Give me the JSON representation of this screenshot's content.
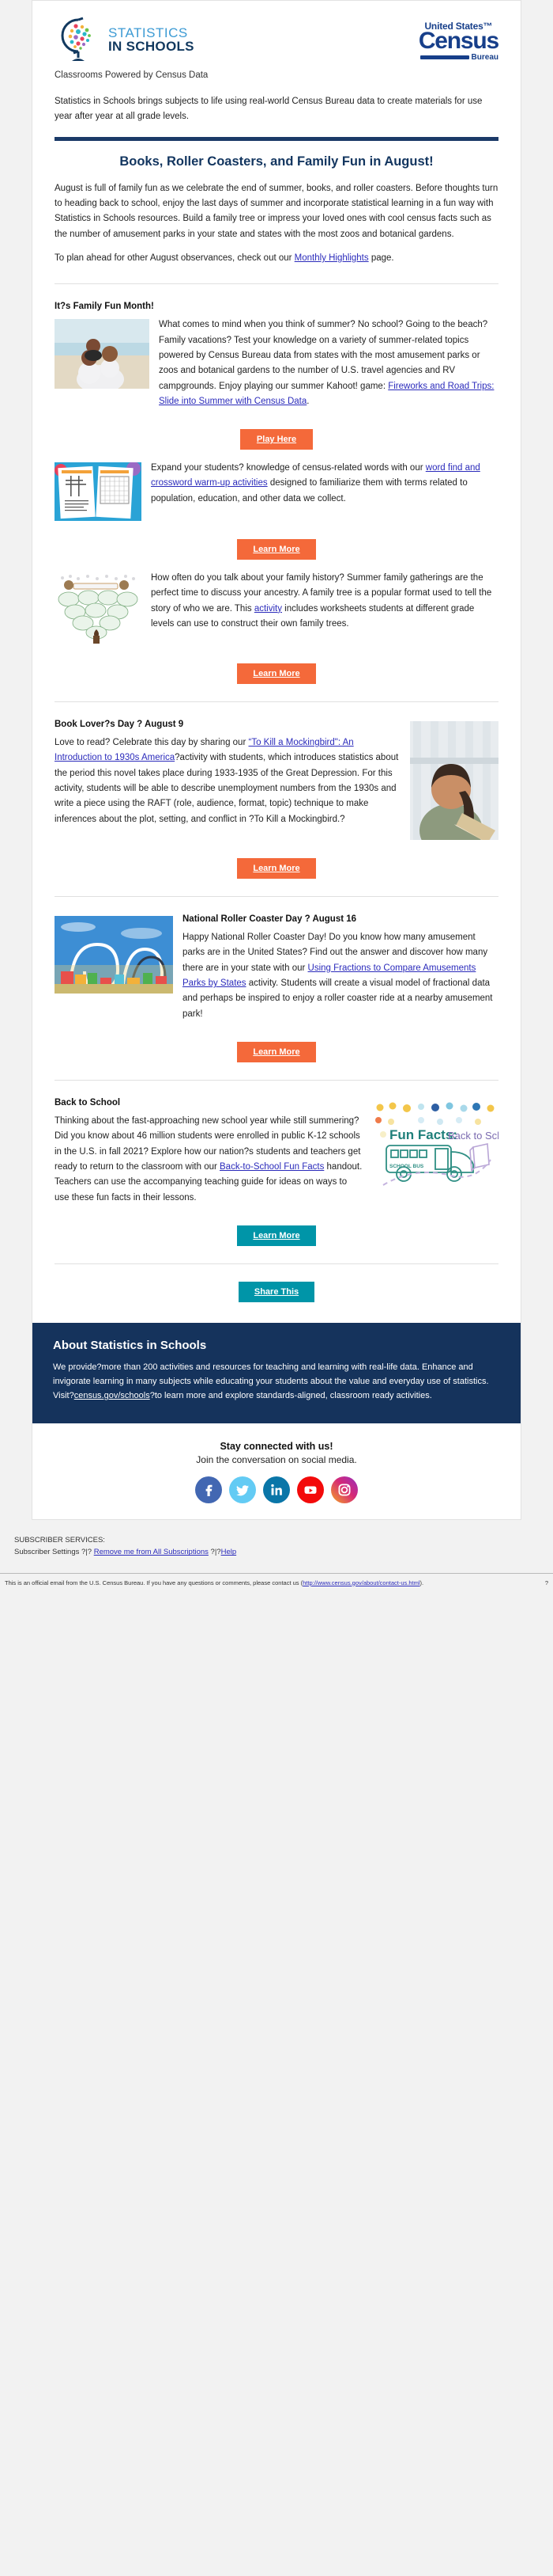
{
  "header": {
    "logo_line1": "STATISTICS",
    "logo_line2": "IN SCHOOLS",
    "census_us": "United States™",
    "census_name": "Census",
    "census_bureau": "Bureau",
    "tagline": "Classrooms Powered by Census Data"
  },
  "intro": "Statistics in Schools brings subjects to life using real-world Census Bureau data to create materials for use year after year at all grade levels.",
  "headline": "Books, Roller Coasters, and Family Fun in August!",
  "lede": {
    "p1": "August is full of family fun as we celebrate the end of summer, books, and roller coasters. Before thoughts turn to heading back to school, enjoy the last days of summer and incorporate statistical learning in a fun way with Statistics in Schools resources. Build a family tree or impress your loved ones with cool census facts such as the number of amusement parks in your state and states with the most zoos and botanical gardens.",
    "p2_before": "To plan ahead for other August observances, check out our ",
    "p2_link": "Monthly Highlights",
    "p2_after": " page."
  },
  "family_fun": {
    "title": "It?s Family Fun Month!",
    "block1": {
      "text_before": "What comes to mind when you think of summer? No school? Going to the beach? Family vacations? Test your knowledge on a variety of summer-related topics powered by Census Bureau data from states with the most amusement parks or zoos and botanical gardens to the number of U.S. travel agencies and RV campgrounds. Enjoy playing our summer Kahoot! game: ",
      "link": "Fireworks and Road Trips: Slide into Summer with Census Data",
      "text_after": ".",
      "button": "Play Here",
      "image_alt": "family-beach-photo"
    },
    "block2": {
      "text_before": "Expand your students? knowledge of census-related words with our ",
      "link": "word find and crossword warm-up activities",
      "text_after": " designed to familiarize them with terms related to population, education, and other data we collect.",
      "button": "Learn More",
      "image_alt": "crossword-worksheets-thumbnail"
    },
    "block3": {
      "text_before": "How often do you talk about your family history? Summer family gatherings are the perfect time to discuss your ancestry. A family tree is a popular format used to tell the story of who we are. This ",
      "link": "activity",
      "text_after": " includes worksheets students at different grade levels can use to construct their own family trees.",
      "button": "Learn More",
      "image_alt": "family-tree-worksheet-thumbnail"
    }
  },
  "book_lovers": {
    "title": "Book Lover?s Day ? August 9",
    "text_before": "Love to read? Celebrate this day by sharing our ",
    "link": "“To Kill a Mockingbird\": An Introduction to 1930s America",
    "text_after": "?activity with students, which introduces statistics about the period this novel takes place during 1933-1935 of the Great Depression. For this activity, students will be able to describe unemployment numbers from the 1930s and write a piece using the RAFT (role, audience, format, topic) technique to make inferences about the plot, setting, and conflict in ?To Kill a Mockingbird.?",
    "button": "Learn More",
    "image_alt": "girl-reading-book-photo"
  },
  "roller_coaster": {
    "title": "National Roller Coaster Day ? August 16",
    "text_before": "Happy National Roller Coaster Day! Do you know how many amusement parks are in the United States? Find out the answer and discover how many there are in your state with our ",
    "link": "Using Fractions to Compare Amusements Parks by States",
    "text_after": " activity. Students will create a visual model of fractional data and perhaps be inspired to enjoy a roller coaster ride at a nearby amusement park!",
    "button": "Learn More",
    "image_alt": "roller-coaster-photo"
  },
  "back_to_school": {
    "title": "Back to School",
    "text_before": "Thinking about the fast-approaching new school year while still summering? Did you know about 46 million students were enrolled in public K-12 schools in the U.S. in fall 2021? Explore how our nation?s students and teachers get ready to return to the classroom with our ",
    "link": "Back-to-School Fun Facts",
    "text_after": " handout. Teachers can use the accompanying teaching guide for ideas on ways to use these fun facts in their lessons.",
    "button": "Learn More",
    "image_alt": "fun-facts-back-to-school-bus-graphic",
    "image_caption_bold": "Fun Facts:",
    "image_caption_rest": " Back to School",
    "bus_label": "SCHOOL BUS"
  },
  "share_button": "Share This",
  "about": {
    "title": "About Statistics in Schools",
    "text_before": "We provide?more than 200 activities and resources for teaching and learning with real-life data. Enhance and invigorate learning in many subjects while educating your students about the value and everyday use of statistics. Visit?",
    "link": "census.gov/schools",
    "text_after": "?to learn more and explore standards-aligned, classroom ready activities."
  },
  "social": {
    "title": "Stay connected with us!",
    "subtitle": "Join the conversation on social media.",
    "items": [
      {
        "name": "facebook",
        "color": "#4267B2"
      },
      {
        "name": "twitter",
        "color": "#63CBF4"
      },
      {
        "name": "linkedin",
        "color": "#0A76A8"
      },
      {
        "name": "youtube",
        "color": "#F30A0A"
      },
      {
        "name": "instagram",
        "color": "#C32AA3"
      }
    ]
  },
  "subscriber": {
    "heading": "SUBSCRIBER SERVICES:",
    "settings": "Subscriber Settings ?|?",
    "remove": "Remove me from All Subscriptions",
    "sep2": "?|?",
    "help": "Help"
  },
  "footnote": {
    "text_before": "This is an official email from the U.S. Census Bureau. If you have any questions or comments, please contact us (",
    "link": "http://www.census.gov/about/contact-us.html",
    "text_after": ").",
    "mark": "?"
  },
  "colors": {
    "orange": "#f4693a",
    "teal": "#0095a8",
    "navy": "#15335c",
    "link": "#2b2bbb"
  }
}
